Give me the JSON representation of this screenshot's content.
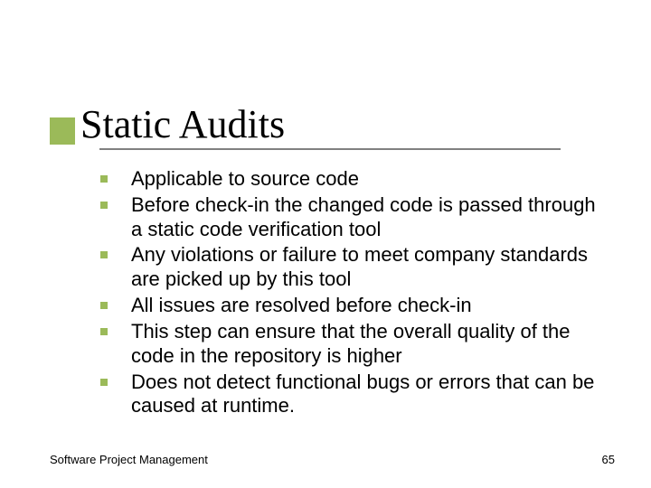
{
  "title": "Static Audits",
  "bullets": [
    "Applicable to source code",
    "Before check-in the changed code is passed through a static code verification tool",
    "Any violations or failure to meet company standards are picked up by this tool",
    "All issues are resolved before check-in",
    "This step can ensure that the overall quality of the code in the repository is higher",
    "Does not detect functional bugs or errors that can be caused at runtime."
  ],
  "footer": {
    "left": "Software Project Management",
    "page": "65"
  },
  "colors": {
    "accent": "#9bba59",
    "rule": "#808080"
  }
}
